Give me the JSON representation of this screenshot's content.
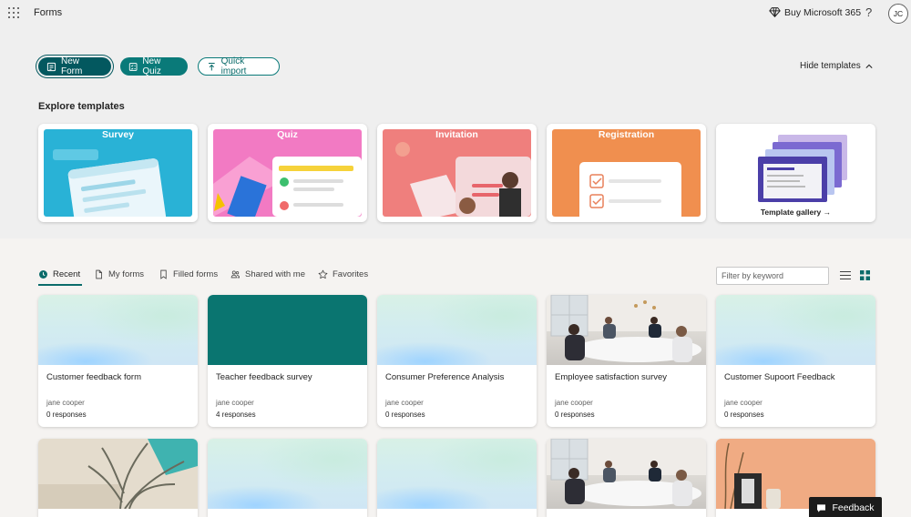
{
  "app": {
    "title": "Forms",
    "buy_label": "Buy Microsoft 365",
    "help_label": "?",
    "avatar_initials": "JC"
  },
  "actions": {
    "new_form": "New Form",
    "new_quiz": "New Quiz",
    "quick_import": "Quick import",
    "hide_templates": "Hide templates"
  },
  "templates": {
    "title": "Explore templates",
    "items": [
      {
        "label": "Survey",
        "color": "#29b2d6"
      },
      {
        "label": "Quiz",
        "color": "#f27ac3"
      },
      {
        "label": "Invitation",
        "color": "#ef7f7d"
      },
      {
        "label": "Registration",
        "color": "#f08f4f"
      }
    ],
    "gallery_label": "Template gallery →"
  },
  "tabs": [
    {
      "label": "Recent",
      "icon": "clock-icon",
      "active": true
    },
    {
      "label": "My forms",
      "icon": "document-icon",
      "active": false
    },
    {
      "label": "Filled forms",
      "icon": "bookmark-icon",
      "active": false
    },
    {
      "label": "Shared with me",
      "icon": "people-icon",
      "active": false
    },
    {
      "label": "Favorites",
      "icon": "star-icon",
      "active": false
    }
  ],
  "filter": {
    "placeholder": "Filter by keyword"
  },
  "forms": [
    {
      "title": "Customer feedback form",
      "owner": "jane cooper",
      "responses": "0 responses",
      "thumb": "pastel"
    },
    {
      "title": "Teacher feedback survey",
      "owner": "jane cooper",
      "responses": "4 responses",
      "thumb": "teal"
    },
    {
      "title": "Consumer Preference Analysis",
      "owner": "jane cooper",
      "responses": "0 responses",
      "thumb": "pastel"
    },
    {
      "title": "Employee satisfaction survey",
      "owner": "jane cooper",
      "responses": "0 responses",
      "thumb": "office"
    },
    {
      "title": "Customer Supoort Feedback",
      "owner": "jane cooper",
      "responses": "0 responses",
      "thumb": "pastel"
    }
  ],
  "feedback": {
    "label": "Feedback"
  },
  "colors": {
    "accent": "#0a7a79",
    "accent_dark": "#03585f"
  }
}
